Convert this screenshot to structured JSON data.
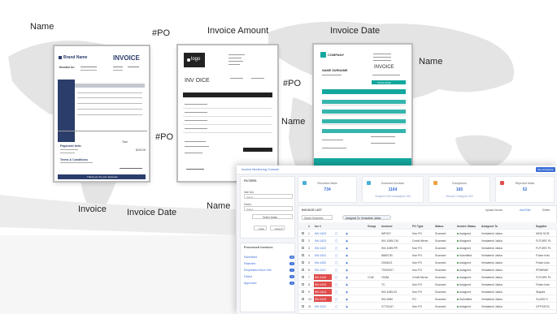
{
  "labels": {
    "name_left": "Name",
    "po_left": "#PO",
    "invoice_amount": "Invoice Amount",
    "invoice_date_top": "Invoice Date",
    "name_right": "Name",
    "po_mid": "#PO",
    "name_mid": "Name",
    "po_left2": "#PO",
    "invoice_bottom": "Invoice",
    "invoice_date_bottom": "Invoice Date",
    "name_bottom": "Name"
  },
  "doc1": {
    "brand": "Brand Name",
    "title": "INVOICE",
    "invoice_to": "Invoice to:",
    "payment_info": "Payment Info:",
    "terms": "Terms & Conditions",
    "footer": "Thank you for your business",
    "total_label": "Total",
    "total_value": "$200.00"
  },
  "doc2": {
    "logo": "logo",
    "title": "INV OICE",
    "footer_name": "THANKY YOUR BUS"
  },
  "doc3": {
    "company": "COMPANY",
    "title": "INVOICE",
    "to_name": "NAME SURNAME",
    "total_label": "TOTAL DUE"
  },
  "dashboard": {
    "banner": "Invoice Monitoring Console",
    "top_button": "My workspace",
    "cards": [
      {
        "title": "Received Mails",
        "value": "734",
        "sub": "",
        "color": "#4ab0d6"
      },
      {
        "title": "Scanned Invoices",
        "value": "1164",
        "sub": "Assigned  153   Unassigned  156",
        "color": "#4ab0d6"
      },
      {
        "title": "Exceptions",
        "value": "165",
        "sub": "Manual  2    Assigned  163",
        "color": "#f0a040"
      },
      {
        "title": "Rejected Mails",
        "value": "52",
        "sub": "",
        "color": "#e05050"
      }
    ],
    "filters": {
      "title": "FILTERS",
      "mail_box_label": "Mail Box",
      "mail_box_value": "Select",
      "status_label": "Status",
      "status_value": "Status",
      "select_dates": "Select Dates",
      "clear": "Clear",
      "search": "Search"
    },
    "processed": {
      "title": "Processed Invoices",
      "items": [
        {
          "label": "Submitted",
          "count": "10"
        },
        {
          "label": "Rejected",
          "count": "2"
        },
        {
          "label": "Requested More Info",
          "count": "1"
        },
        {
          "label": "Failed",
          "count": "0"
        },
        {
          "label": "Approved",
          "count": "0"
        }
      ]
    },
    "list": {
      "title": "INVOICE LIST",
      "upload": "Upload Invoice",
      "add_filter": "Add Filter",
      "delete": "Delete",
      "saved_searches": "Saved Searches",
      "assigned_filter": "Assigned To: Venkatesh Jakka",
      "headers": [
        "#",
        "Inv #",
        "",
        "",
        "Group",
        "Invoice#",
        "PO Type",
        "Status",
        "Invoice Status",
        "Assigned To",
        "Supplier"
      ],
      "rows": [
        [
          "1",
          "INV-1624",
          "",
          "",
          "",
          "INPO07",
          "Non PO",
          "Scanned",
          "Assigned",
          "Venkatesh Jakka",
          "NEW SCIE"
        ],
        [
          "2",
          "INV-1623",
          "",
          "",
          "",
          "INV-1089-CM",
          "Credit Memo",
          "Scanned",
          "Assigned",
          "Venkatesh Jakka",
          "FUTURE PL"
        ],
        [
          "3",
          "INV-1622",
          "",
          "",
          "",
          "INV-1089-PR",
          "Non PO",
          "Scanned",
          "Assigned",
          "Venkatesh Jakka",
          "FUTURE PL"
        ],
        [
          "4",
          "INV-1621",
          "",
          "",
          "",
          "856971B",
          "Non PO",
          "Scanned",
          "Submitted",
          "Venkatesh Jakka",
          "Fulton Inds"
        ],
        [
          "5",
          "INV-1620",
          "",
          "",
          "",
          "2000613",
          "Non PO",
          "Scanned",
          "Assigned",
          "Venkatesh Jakka",
          "Fulton Inds"
        ],
        [
          "6",
          "INV-1617",
          "",
          "",
          "",
          "T0000017",
          "Non PO",
          "Scanned",
          "Assigned",
          "Venkatesh Jakka",
          "PRIMRAE"
        ],
        [
          "7",
          "INV-1616",
          "",
          "",
          "1748",
          "19284",
          "Credit Memo",
          "Scanned",
          "Assigned",
          "Venkatesh Jakka",
          "FUTURE PL"
        ],
        [
          "8",
          "INV-1615",
          "",
          "",
          "",
          "TC",
          "Non PO",
          "Scanned",
          "Assigned",
          "Venkatesh Jakka",
          "Fulton Inds"
        ],
        [
          "9",
          "INV-1614",
          "",
          "",
          "",
          "INV-1089-00",
          "Non PO",
          "Scanned",
          "Assigned",
          "Venkatesh Jakka",
          "Staples"
        ],
        [
          "10",
          "INV-1613",
          "",
          "",
          "",
          "INV-4080",
          "PO",
          "Scanned",
          "Submitted",
          "Venkatesh Jakka",
          "GLASS D"
        ],
        [
          "11",
          "INV-1612",
          "",
          "",
          "",
          "07731347",
          "Non PO",
          "Scanned",
          "Assigned",
          "Venkatesh Jakka",
          "OFFICESC"
        ]
      ]
    }
  }
}
